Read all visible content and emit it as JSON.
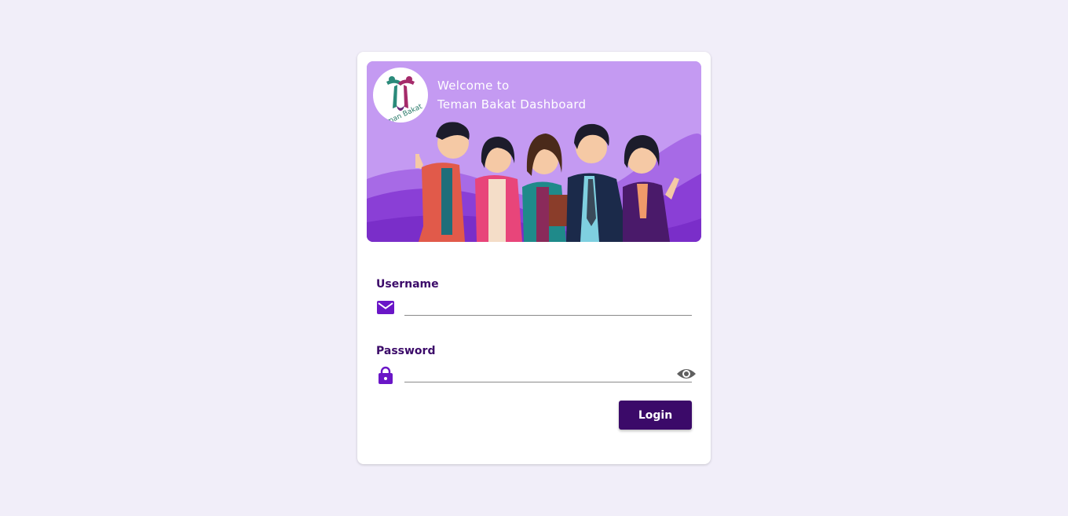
{
  "banner": {
    "welcome_line1": "Welcome to",
    "welcome_line2": "Teman Bakat Dashboard",
    "logo_text": "Teman Bakat",
    "background_color": "#c49af2",
    "hill_color": "#8a3fd6"
  },
  "form": {
    "username_label": "Username",
    "username_value": "",
    "username_icon": "mail-icon",
    "password_label": "Password",
    "password_value": "",
    "password_icon": "lock-icon",
    "toggle_icon": "eye-icon",
    "login_label": "Login"
  },
  "colors": {
    "page_background": "#f1eef9",
    "primary": "#3b0a69",
    "icon": "#6a16c7"
  }
}
